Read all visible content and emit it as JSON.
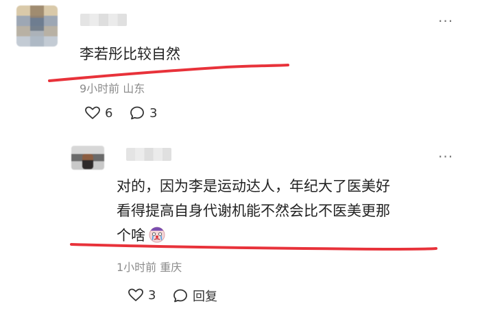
{
  "top_comment": {
    "text": "李若彤比较自然",
    "meta": "9小时前 山东",
    "like_count": "6",
    "comment_count": "3",
    "icons": {
      "like": "heart-outline-icon",
      "comment": "speech-bubble-icon",
      "more": "more-dots-icon"
    }
  },
  "reply": {
    "lines": [
      "对的，因为李是运动达人，年纪大了医美好",
      "看得提高自身代谢机能不然会比不医美更那",
      "个啥"
    ],
    "sticker": "crying-clown-emoji",
    "meta": "1小时前 重庆",
    "like_count": "3",
    "reply_label": "回复",
    "icons": {
      "like": "heart-outline-icon",
      "reply": "speech-bubble-icon",
      "more": "more-dots-icon"
    }
  },
  "colors": {
    "annotation_underline": "#e8323a",
    "meta_text": "#8b8b8b",
    "body_text": "#222222"
  }
}
